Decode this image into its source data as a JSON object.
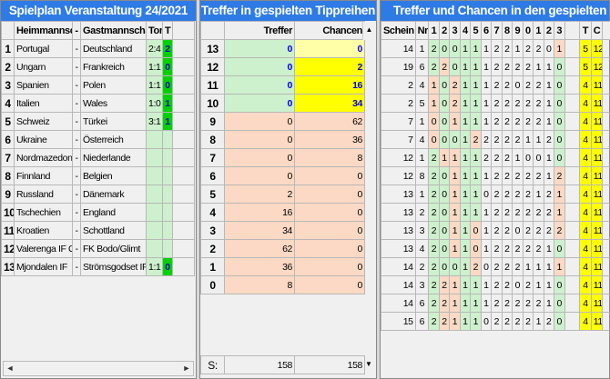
{
  "panel1": {
    "title": "Spielplan Veranstaltung 24/2021",
    "headers": {
      "home": "Heimmannschaft",
      "dash": "-",
      "away": "Gastmannschaft",
      "tor": "Tor",
      "t": "T"
    },
    "rows": [
      {
        "n": "1",
        "home": "Portugal",
        "away": "Deutschland",
        "tor": "2:4",
        "t": "2"
      },
      {
        "n": "2",
        "home": "Ungarn",
        "away": "Frankreich",
        "tor": "1:1",
        "t": "0"
      },
      {
        "n": "3",
        "home": "Spanien",
        "away": "Polen",
        "tor": "1:1",
        "t": "0"
      },
      {
        "n": "4",
        "home": "Italien",
        "away": "Wales",
        "tor": "1:0",
        "t": "1"
      },
      {
        "n": "5",
        "home": "Schweiz",
        "away": "Türkei",
        "tor": "3:1",
        "t": "1"
      },
      {
        "n": "6",
        "home": "Ukraine",
        "away": "Österreich",
        "tor": "",
        "t": ""
      },
      {
        "n": "7",
        "home": "Nordmazedonien",
        "away": "Niederlande",
        "tor": "",
        "t": ""
      },
      {
        "n": "8",
        "home": "Finnland",
        "away": "Belgien",
        "tor": "",
        "t": ""
      },
      {
        "n": "9",
        "home": "Russland",
        "away": "Dänemark",
        "tor": "",
        "t": ""
      },
      {
        "n": "10",
        "home": "Tschechien",
        "away": "England",
        "tor": "",
        "t": ""
      },
      {
        "n": "11",
        "home": "Kroatien",
        "away": "Schottland",
        "tor": "",
        "t": ""
      },
      {
        "n": "12",
        "home": "Valerenga IF Oslo",
        "away": "FK Bodo/Glimt",
        "tor": "",
        "t": ""
      },
      {
        "n": "13",
        "home": "Mjondalen IF",
        "away": "Strömsgodset IF",
        "tor": "1:1",
        "t": "0"
      }
    ],
    "sep": "-",
    "scroll_left": "◄",
    "scroll_right": "►"
  },
  "panel2": {
    "title": "Treffer in gespielten Tippreihen",
    "headers": {
      "treffer": "Treffer",
      "chancen": "Chancen"
    },
    "rows": [
      {
        "n": "13",
        "treffer": "0",
        "chancen": "0"
      },
      {
        "n": "12",
        "treffer": "0",
        "chancen": "2"
      },
      {
        "n": "11",
        "treffer": "0",
        "chancen": "16"
      },
      {
        "n": "10",
        "treffer": "0",
        "chancen": "34"
      },
      {
        "n": "9",
        "treffer": "0",
        "chancen": "62"
      },
      {
        "n": "8",
        "treffer": "0",
        "chancen": "36"
      },
      {
        "n": "7",
        "treffer": "0",
        "chancen": "8"
      },
      {
        "n": "6",
        "treffer": "0",
        "chancen": "0"
      },
      {
        "n": "5",
        "treffer": "2",
        "chancen": "0"
      },
      {
        "n": "4",
        "treffer": "16",
        "chancen": "0"
      },
      {
        "n": "3",
        "treffer": "34",
        "chancen": "0"
      },
      {
        "n": "2",
        "treffer": "62",
        "chancen": "0"
      },
      {
        "n": "1",
        "treffer": "36",
        "chancen": "0"
      },
      {
        "n": "0",
        "treffer": "8",
        "chancen": "0"
      }
    ],
    "sum_label": "S:",
    "sum_treffer": "158",
    "sum_chancen": "158",
    "scroll_up": "▲",
    "scroll_down": "▼"
  },
  "panel3": {
    "title": "Treffer und Chancen in den gespielten Tipp",
    "headers": {
      "schein": "Schein",
      "nr": "Nr",
      "cols": [
        "1",
        "2",
        "3",
        "4",
        "5",
        "6",
        "7",
        "8",
        "9",
        "0",
        "1",
        "2",
        "3"
      ],
      "t": "T",
      "c": "C"
    },
    "rows": [
      {
        "schein": "14",
        "nr": "1",
        "d": [
          "2",
          "0",
          "0",
          "1",
          "1",
          "1",
          "2",
          "2",
          "1",
          "2",
          "2",
          "0",
          "1"
        ],
        "t": "5",
        "c": "12"
      },
      {
        "schein": "19",
        "nr": "6",
        "d": [
          "2",
          "2",
          "0",
          "1",
          "1",
          "1",
          "2",
          "2",
          "2",
          "2",
          "1",
          "1",
          "0"
        ],
        "t": "5",
        "c": "12"
      },
      {
        "schein": "2",
        "nr": "4",
        "d": [
          "1",
          "0",
          "2",
          "1",
          "1",
          "1",
          "2",
          "2",
          "0",
          "2",
          "2",
          "1",
          "0"
        ],
        "t": "4",
        "c": "11"
      },
      {
        "schein": "2",
        "nr": "5",
        "d": [
          "1",
          "0",
          "2",
          "1",
          "1",
          "1",
          "2",
          "2",
          "2",
          "2",
          "2",
          "1",
          "0"
        ],
        "t": "4",
        "c": "11"
      },
      {
        "schein": "7",
        "nr": "1",
        "d": [
          "0",
          "0",
          "1",
          "1",
          "1",
          "1",
          "2",
          "2",
          "2",
          "2",
          "2",
          "1",
          "0"
        ],
        "t": "4",
        "c": "11"
      },
      {
        "schein": "7",
        "nr": "4",
        "d": [
          "0",
          "0",
          "0",
          "1",
          "2",
          "2",
          "2",
          "2",
          "2",
          "1",
          "1",
          "2",
          "0"
        ],
        "t": "4",
        "c": "11"
      },
      {
        "schein": "12",
        "nr": "1",
        "d": [
          "2",
          "1",
          "1",
          "1",
          "1",
          "2",
          "2",
          "2",
          "1",
          "0",
          "0",
          "1",
          "0"
        ],
        "t": "4",
        "c": "11"
      },
      {
        "schein": "12",
        "nr": "8",
        "d": [
          "2",
          "0",
          "1",
          "1",
          "1",
          "1",
          "2",
          "2",
          "2",
          "2",
          "2",
          "1",
          "2"
        ],
        "t": "4",
        "c": "11"
      },
      {
        "schein": "13",
        "nr": "1",
        "d": [
          "2",
          "0",
          "1",
          "1",
          "1",
          "0",
          "2",
          "2",
          "2",
          "2",
          "1",
          "2",
          "1"
        ],
        "t": "4",
        "c": "11"
      },
      {
        "schein": "13",
        "nr": "2",
        "d": [
          "2",
          "0",
          "1",
          "1",
          "1",
          "1",
          "2",
          "2",
          "2",
          "2",
          "2",
          "2",
          "1"
        ],
        "t": "4",
        "c": "11"
      },
      {
        "schein": "13",
        "nr": "3",
        "d": [
          "2",
          "0",
          "1",
          "1",
          "0",
          "1",
          "2",
          "2",
          "0",
          "2",
          "2",
          "2",
          "2"
        ],
        "t": "4",
        "c": "11"
      },
      {
        "schein": "13",
        "nr": "4",
        "d": [
          "2",
          "0",
          "1",
          "1",
          "0",
          "1",
          "2",
          "2",
          "2",
          "2",
          "2",
          "1",
          "0"
        ],
        "t": "4",
        "c": "11"
      },
      {
        "schein": "14",
        "nr": "2",
        "d": [
          "2",
          "0",
          "0",
          "1",
          "2",
          "0",
          "2",
          "2",
          "2",
          "1",
          "1",
          "1",
          "1"
        ],
        "t": "4",
        "c": "11"
      },
      {
        "schein": "14",
        "nr": "3",
        "d": [
          "2",
          "2",
          "1",
          "1",
          "1",
          "1",
          "2",
          "2",
          "0",
          "2",
          "1",
          "1",
          "0"
        ],
        "t": "4",
        "c": "11"
      },
      {
        "schein": "14",
        "nr": "6",
        "d": [
          "2",
          "2",
          "1",
          "1",
          "1",
          "1",
          "2",
          "2",
          "2",
          "2",
          "2",
          "1",
          "0"
        ],
        "t": "4",
        "c": "11"
      },
      {
        "schein": "15",
        "nr": "6",
        "d": [
          "2",
          "2",
          "1",
          "1",
          "1",
          "0",
          "2",
          "2",
          "2",
          "2",
          "1",
          "2",
          "0"
        ],
        "t": "4",
        "c": "11"
      }
    ],
    "colors": {
      "green": "#cdf0cd",
      "peach": "#fbd9c4"
    }
  }
}
